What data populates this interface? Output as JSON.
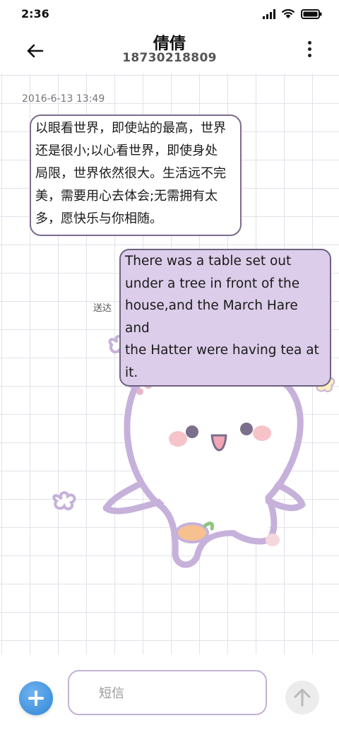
{
  "status_bar": {
    "time": "2:36",
    "icons": [
      "signal-icon",
      "wifi-icon",
      "battery-icon"
    ]
  },
  "header": {
    "contact_name": "倩倩",
    "phone_number": "18730218809",
    "icons": [
      "back-arrow-icon",
      "more-vertical-icon"
    ]
  },
  "conversation": {
    "timestamp": "2016-6-13 13:49",
    "incoming": {
      "lines": [
        "以眼看世界，即使站的最高，世界",
        "还是很小;以心看世界，即使身处",
        "局限，世界依然很大。生活远不完",
        "美，需要用心去体会;无需拥有太",
        "多，愿快乐与你相随。"
      ]
    },
    "outgoing": {
      "status": "送达",
      "lines": [
        "There was a table set out",
        "under a tree in front of the",
        "house,and the March Hare and",
        "the Hatter were having tea at",
        "it."
      ]
    }
  },
  "composer": {
    "placeholder": "短信",
    "value": "",
    "icons": [
      "add-icon",
      "send-arrow-icon"
    ]
  },
  "colors": {
    "grid_line": "#e3e1ea",
    "incoming_border": "#7c6b8e",
    "outgoing_fill": "#dccdea",
    "outgoing_border": "#6e6180",
    "input_border": "#c4b0d8",
    "add_button": "#2f86d8",
    "send_button": "#ececec",
    "sticker_outline": "#c6b1db"
  }
}
